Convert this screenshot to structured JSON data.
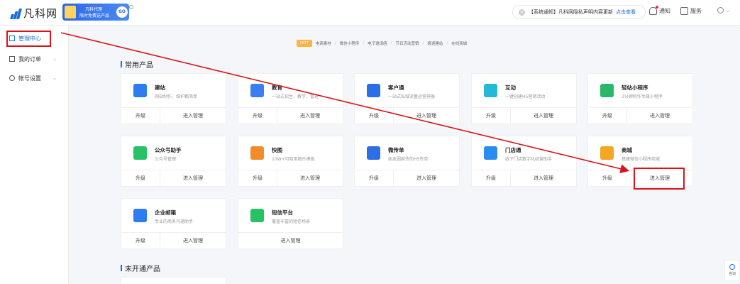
{
  "header": {
    "logo_text": "凡科网",
    "promo_line1": "凡科代理",
    "promo_line2": "限时免费送产品",
    "promo_go": "GO",
    "notice_text": "【系统通知】凡科网隐私声明内容更新",
    "notice_link": "点击查看",
    "notify_label": "通知",
    "service_label": "服务"
  },
  "sidebar": {
    "items": [
      {
        "label": "管理中心"
      },
      {
        "label": "我的订单"
      },
      {
        "label": "帐号设置"
      }
    ]
  },
  "tags": {
    "hot": "HOT",
    "items": [
      "电商素材",
      "微信小程序",
      "电子邀请函",
      "节日活动营销",
      "极速建站",
      "在线商城"
    ]
  },
  "sections": {
    "common": "常用产品",
    "unopened": "未开通产品"
  },
  "cards": [
    {
      "name": "建站",
      "desc": "网站制作、维护都简单",
      "upgrade": "升级",
      "manage": "进入管理",
      "color": "#2d7cf0",
      "icon": "site-icon"
    },
    {
      "name": "教育",
      "desc": "一站式招生、教学、管理",
      "upgrade": "升级",
      "manage": "进入管理",
      "color": "#3a7ef2",
      "icon": "education-icon"
    },
    {
      "name": "客户通",
      "desc": "一站式私域流量运营神器",
      "upgrade": "升级",
      "manage": "进入管理",
      "color": "#2a6fe8",
      "icon": "customer-icon"
    },
    {
      "name": "互动",
      "desc": "一键创建H5营销活动",
      "upgrade": "升级",
      "manage": "进入管理",
      "color": "#26b8d8",
      "icon": "gift-icon"
    },
    {
      "name": "轻站小程序",
      "desc": "3分钟制作专属小程序",
      "upgrade": "升级",
      "manage": "进入管理",
      "color": "#29b86a",
      "icon": "miniapp-icon"
    },
    {
      "name": "公众号助手",
      "desc": "公众号管理",
      "upgrade": "升级",
      "manage": "进入管理",
      "color": "#27c266",
      "icon": "wechat-icon"
    },
    {
      "name": "快图",
      "desc": "10W+可商用图片模板",
      "upgrade": "升级",
      "manage": "进入管理",
      "color": "#f38b2a",
      "icon": "image-icon"
    },
    {
      "name": "微传单",
      "desc": "朋友圈疯传的H5传单",
      "upgrade": "升级",
      "manage": "进入管理",
      "color": "#2d6fe6",
      "icon": "flyer-icon"
    },
    {
      "name": "门店通",
      "desc": "线下门店数字化经营助手",
      "upgrade": "升级",
      "manage": "进入管理",
      "color": "#2a8cf0",
      "icon": "store-icon"
    },
    {
      "name": "商城",
      "desc": "搭建微信小程序商城",
      "upgrade": "升级",
      "manage": "进入管理",
      "color": "#f5a623",
      "icon": "shop-icon"
    },
    {
      "name": "企业邮箱",
      "desc": "专业的商务沟通助手",
      "upgrade": "升级",
      "manage": "进入管理",
      "color": "#2d7cf0",
      "icon": "mail-icon"
    },
    {
      "name": "短信平台",
      "desc": "覆盖丰富的短信场景",
      "upgrade": "",
      "manage": "进入管理",
      "color": "#27c266",
      "icon": "sms-icon"
    }
  ],
  "float": {
    "label": "咨询"
  },
  "colors": {
    "accent": "#1a6fe0",
    "highlight": "#d8141a"
  }
}
